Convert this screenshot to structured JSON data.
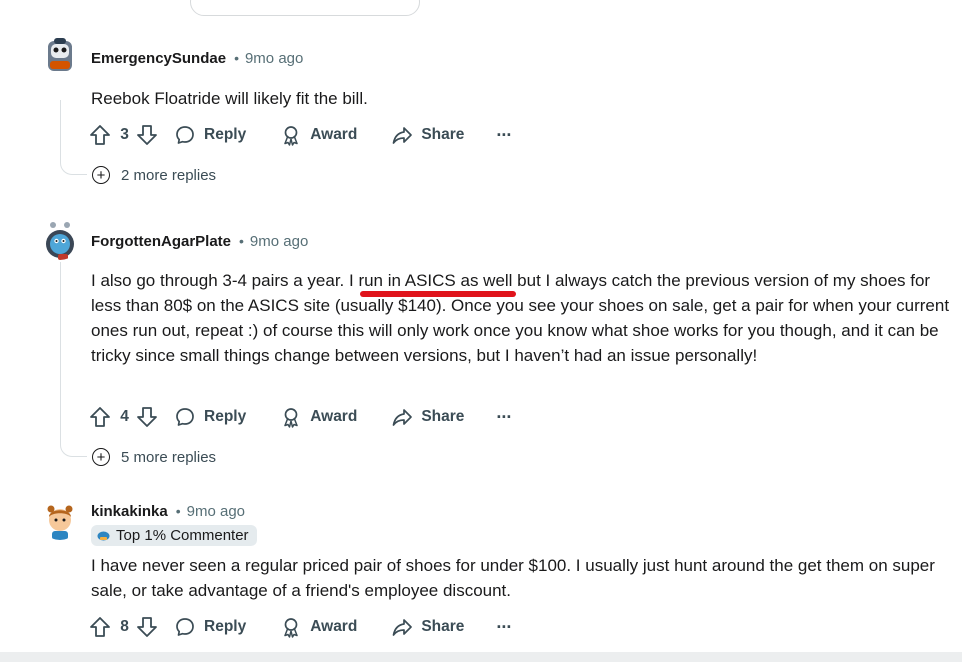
{
  "colors": {
    "highlight": "#e0131b",
    "meta": "#576f76",
    "action": "#3b4c55",
    "badge_bg": "#e5ebee"
  },
  "actions": {
    "reply": "Reply",
    "award": "Award",
    "share": "Share",
    "more": "···"
  },
  "comments": [
    {
      "author": "EmergencySundae",
      "time": "9mo ago",
      "text": "Reebok Floatride will likely fit the bill.",
      "votes": "3",
      "more_replies": "2 more replies"
    },
    {
      "author": "ForgottenAgarPlate",
      "time": "9mo ago",
      "text_before": "I also go through 3-4 pairs a year. I ",
      "text_highlight": "run in ASICS as well",
      "text_after": " but I always catch the previous version of my shoes for less than 80$ on the ASICS site (usually $140). Once you see your shoes on sale, get a pair for when your current ones run out, repeat :) of course this will only work once you know what shoe works for you though, and it can be tricky since small things change between versions, but I haven’t had an issue personally!",
      "votes": "4",
      "more_replies": "5 more replies"
    },
    {
      "author": "kinkakinka",
      "time": "9mo ago",
      "badge": "Top 1% Commenter",
      "text": "I have never seen a regular priced pair of shoes for under $100. I usually just hunt around the get them on super sale, or take advantage of a friend's employee discount.",
      "votes": "8"
    }
  ]
}
